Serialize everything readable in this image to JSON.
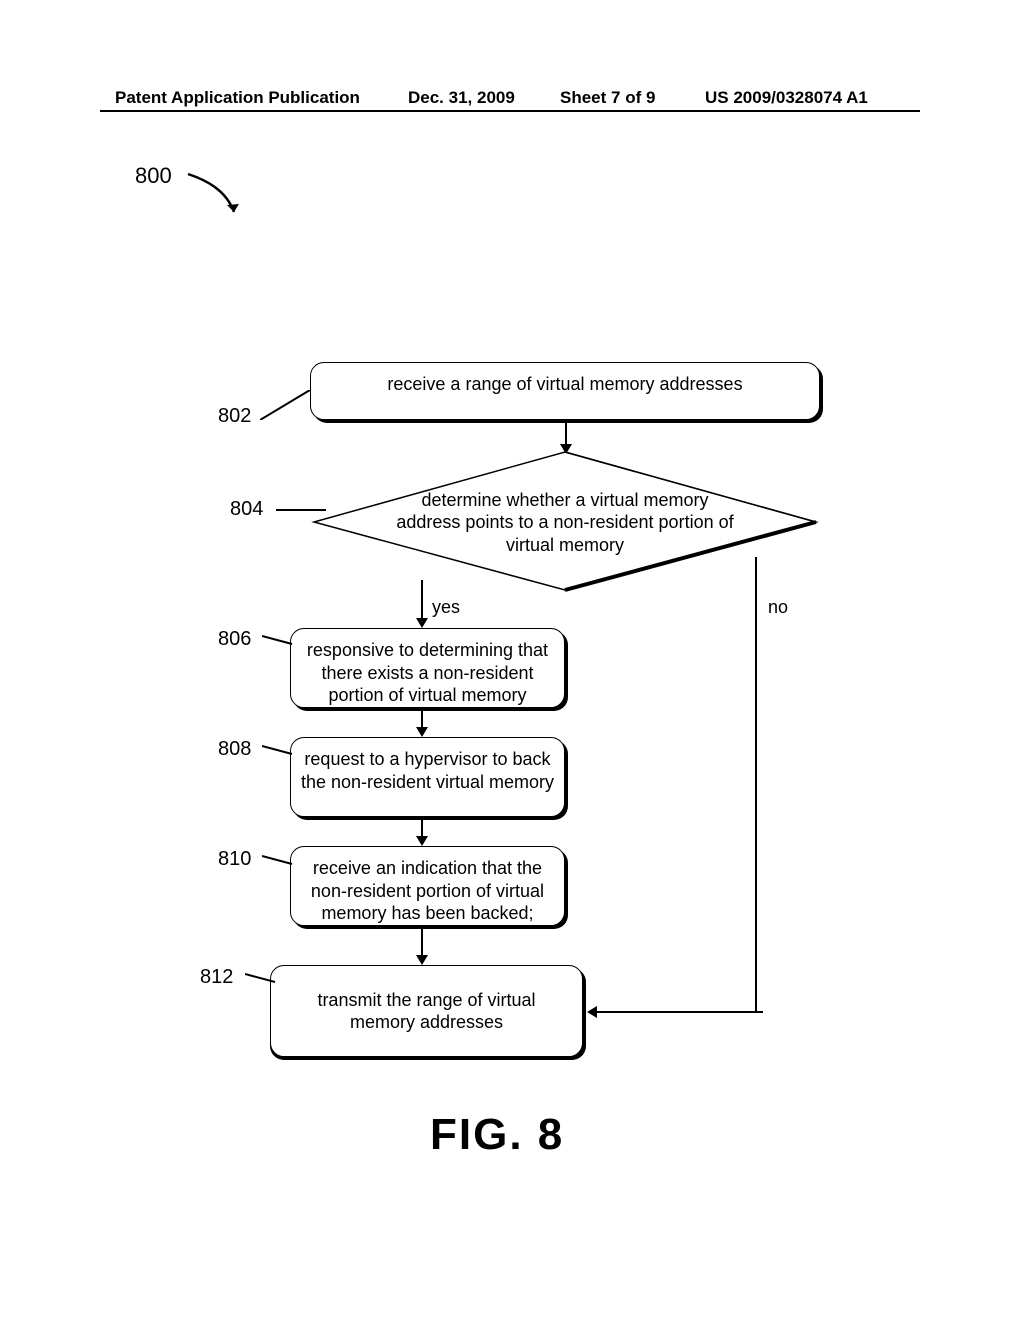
{
  "header": {
    "left": "Patent Application Publication",
    "date": "Dec. 31, 2009",
    "sheet": "Sheet 7 of 9",
    "docnum": "US 2009/0328074 A1"
  },
  "figref": "800",
  "figtitle": "FIG. 8",
  "leaders": {
    "l802": "802",
    "l804": "804",
    "l806": "806",
    "l808": "808",
    "l810": "810",
    "l812": "812"
  },
  "nodes": {
    "n802": "receive a range of virtual memory addresses",
    "n804": "determine whether a virtual memory address points to a non-resident portion of virtual memory",
    "n806": "responsive to determining that there exists a non-resident portion of virtual memory",
    "n808": "request to a hypervisor to back the non-resident virtual memory",
    "n810": "receive an indication that the non-resident portion of virtual memory has been backed;",
    "n812": "transmit the range of virtual memory addresses"
  },
  "branches": {
    "yes": "yes",
    "no": "no"
  }
}
